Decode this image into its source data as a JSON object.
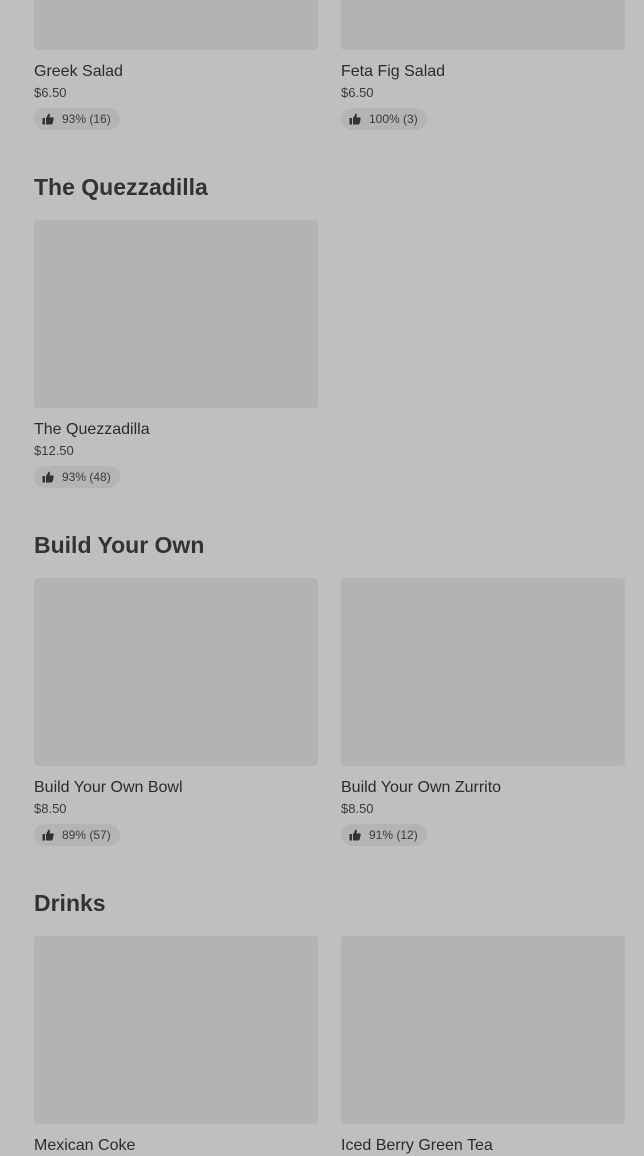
{
  "sections": [
    {
      "title": "",
      "items": [
        {
          "name": "Greek Salad",
          "price": "$6.50",
          "rating": "93% (16)"
        },
        {
          "name": "Feta Fig Salad",
          "price": "$6.50",
          "rating": "100% (3)"
        }
      ]
    },
    {
      "title": "The Quezzadilla",
      "items": [
        {
          "name": "The Quezzadilla",
          "price": "$12.50",
          "rating": "93% (48)"
        }
      ]
    },
    {
      "title": "Build Your Own",
      "items": [
        {
          "name": "Build Your Own Bowl",
          "price": "$8.50",
          "rating": "89% (57)"
        },
        {
          "name": "Build Your Own Zurrito",
          "price": "$8.50",
          "rating": "91% (12)"
        }
      ]
    },
    {
      "title": "Drinks",
      "items": [
        {
          "name": "Mexican Coke"
        },
        {
          "name": "Iced Berry Green Tea"
        }
      ]
    }
  ],
  "icons": {
    "rating": "thumbs-up-icon"
  },
  "colors": {
    "background": "#bfbfbf",
    "image_placeholder": "#b3b3b3",
    "rating_badge": "#b4b4b4",
    "text": "#2b2b2b"
  }
}
